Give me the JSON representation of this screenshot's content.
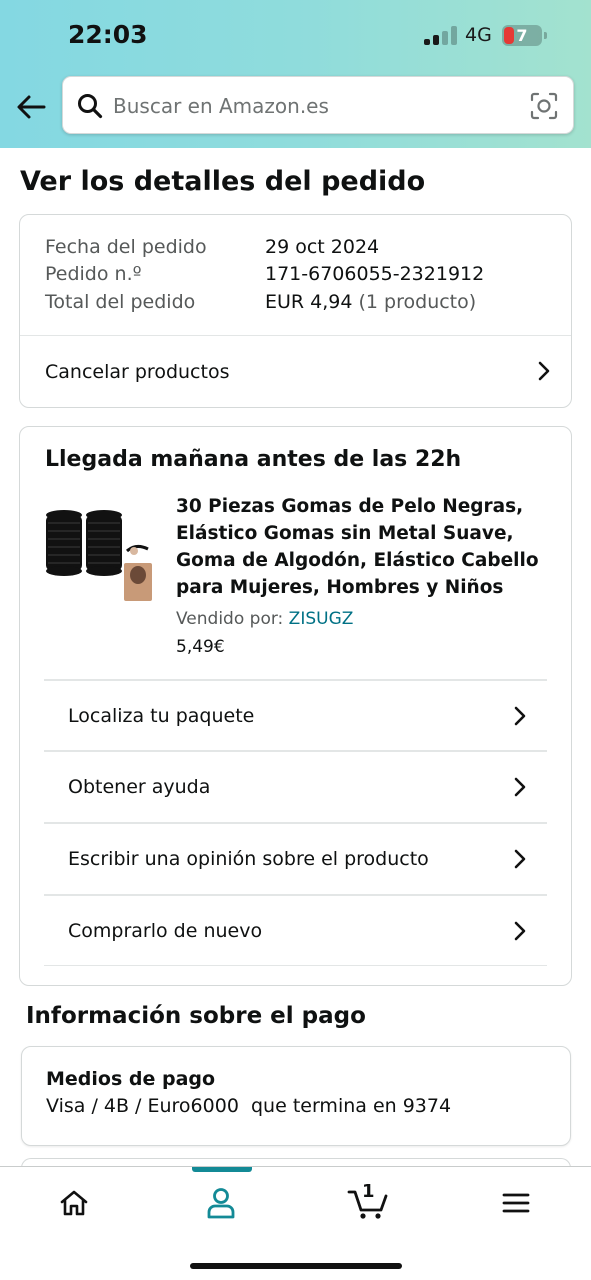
{
  "status_bar": {
    "time": "22:03",
    "network": "4G",
    "battery_level": "7"
  },
  "search": {
    "placeholder": "Buscar en Amazon.es"
  },
  "page_title": "Ver los detalles del pedido",
  "order_summary": {
    "date_label": "Fecha del pedido",
    "date_value": "29 oct 2024",
    "order_number_label": "Pedido n.º",
    "order_number_value": "171-6706055-2321912",
    "total_label": "Total del pedido",
    "total_value": "EUR 4,94",
    "total_items": "(1 producto)",
    "cancel_label": "Cancelar productos"
  },
  "delivery": {
    "heading": "Llegada mañana antes de las 22h",
    "product": {
      "title": "30 Piezas Gomas de Pelo Negras, Elástico Gomas sin Metal Suave, Goma de Algodón, Elástico Cabello para Mujeres, Hombres y Niños",
      "sold_by_label": "Vendido por:",
      "seller": "ZISUGZ",
      "price": "5,49€"
    },
    "actions": [
      {
        "label": "Localiza tu paquete"
      },
      {
        "label": "Obtener ayuda"
      },
      {
        "label": "Escribir una opinión sobre el producto"
      },
      {
        "label": "Comprarlo de nuevo"
      }
    ]
  },
  "payment": {
    "heading": "Información sobre el pago",
    "method_label": "Medios de pago",
    "method_value": "Visa / 4B / Euro6000  que termina en 9374"
  },
  "bottom_nav": {
    "items": [
      {
        "icon": "home-icon"
      },
      {
        "icon": "account-icon",
        "active": true
      },
      {
        "icon": "cart-icon"
      },
      {
        "icon": "menu-icon"
      }
    ],
    "cart_count": "1",
    "accent_color": "#138a96"
  },
  "colors": {
    "link": "#007185",
    "header_gradient_start": "#84d8e2",
    "header_gradient_end": "#a3e2cf"
  }
}
